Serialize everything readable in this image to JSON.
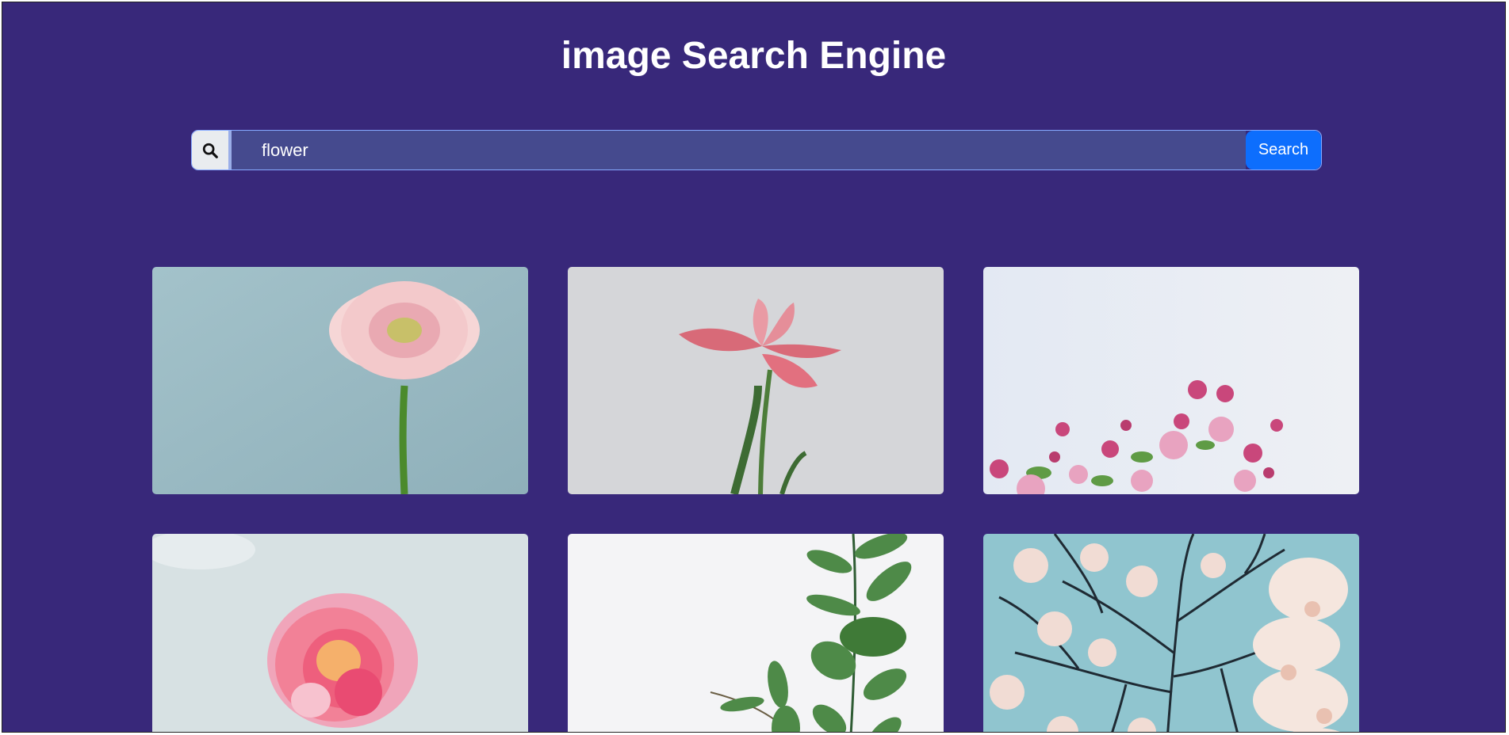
{
  "header": {
    "title": "image Search Engine"
  },
  "search": {
    "icon": "search-icon",
    "value": "flower",
    "button_label": "Search"
  },
  "results": [
    {
      "subject": "pink gerbera daisy",
      "background": "#9dbcc4"
    },
    {
      "subject": "pink lily",
      "background": "#d5d6d8"
    },
    {
      "subject": "pink blossoms",
      "background": "#e6ecf3"
    },
    {
      "subject": "pink rose",
      "background": "#d6e0e2"
    },
    {
      "subject": "eucalyptus leaves",
      "background": "#f4f4f6"
    },
    {
      "subject": "cherry blossom tree",
      "background": "#8fc4cf"
    }
  ],
  "colors": {
    "page_background": "#38287a",
    "input_background": "#454a8e",
    "button_background": "#0d6efd"
  }
}
